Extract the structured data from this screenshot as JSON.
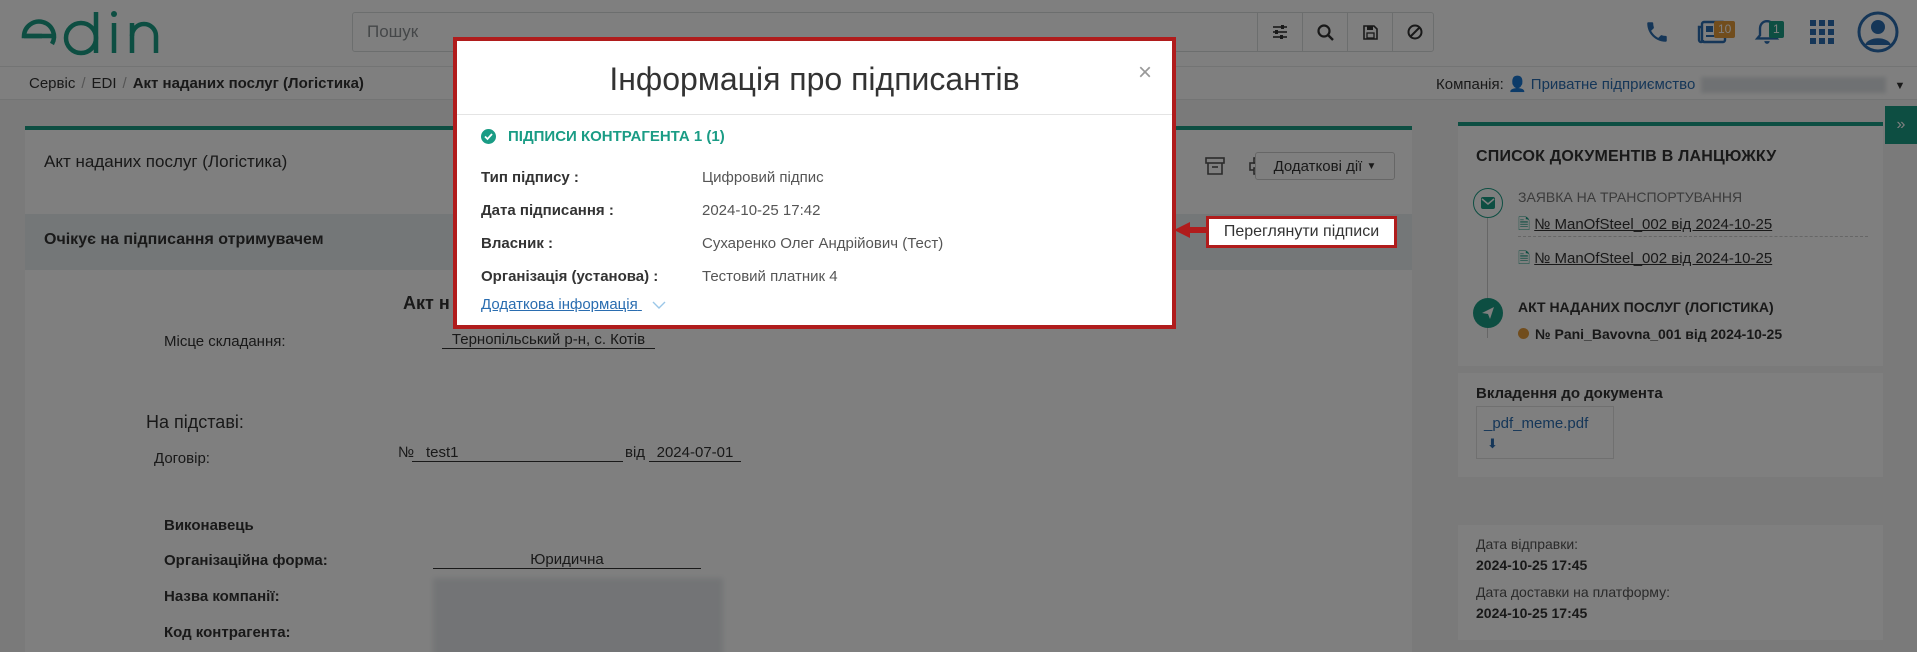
{
  "header": {
    "search_placeholder": "Пошук",
    "catalog_badge": "10",
    "notifications_badge": "1"
  },
  "breadcrumb": {
    "items": [
      "Сервіс",
      "EDI",
      "Акт наданих послуг (Логістика)"
    ],
    "company_label": "Компанія:",
    "company_name": "Приватне підприємство"
  },
  "document": {
    "title": "Акт наданих послуг (Логістика)",
    "status": "Очікує на підписання отримувачем",
    "view_signatures": "Переглянути підписи",
    "more_actions": "Додаткові дії",
    "body_title_fragment": "Акт н",
    "place_label": "Місце складання:",
    "place_value": "Тернопільський р-н, с. Котів",
    "basis_heading": "На підставі:",
    "contract_label": "Договір:",
    "contract_no_prefix": "№",
    "contract_no": "test1",
    "contract_from": "від",
    "contract_date": "2024-07-01",
    "executor_heading": "Виконавець",
    "org_form_label": "Організаційна форма:",
    "org_form_value": "Юридична",
    "company_name_label": "Назва компанії:",
    "counterparty_code_label": "Код контрагента:"
  },
  "chain": {
    "heading": "СПИСОК ДОКУМЕНТІВ В ЛАНЦЮЖКУ",
    "group1_title": "ЗАЯВКА НА ТРАНСПОРТУВАННЯ",
    "group1_docs": [
      "№ ManOfSteel_002 від 2024-10-25",
      "№ ManOfSteel_002 від 2024-10-25"
    ],
    "group2_title": "АКТ НАДАНИХ ПОСЛУГ (ЛОГІСТИКА)",
    "group2_doc": "№ Pani_Bavovna_001 від 2024-10-25"
  },
  "attachments": {
    "heading": "Вкладення до документа",
    "file": "_pdf_meme.pdf"
  },
  "dates": {
    "sent_label": "Дата відправки:",
    "sent_value": "2024-10-25 17:45",
    "delivered_label": "Дата доставки на платформу:",
    "delivered_value": "2024-10-25 17:45"
  },
  "modal": {
    "title": "Інформація про підписантів",
    "close": "×",
    "section": "ПІДПИСИ КОНТРАГЕНТА 1 (1)",
    "rows": [
      {
        "label": "Тип підпису :",
        "value": "Цифровий підпис"
      },
      {
        "label": "Дата підписання :",
        "value": "2024-10-25 17:42"
      },
      {
        "label": "Власник :",
        "value": "Сухаренко Олег Андрійович (Тест)"
      },
      {
        "label": "Організація (установа) :",
        "value": "Тестовий платник 4"
      }
    ],
    "more_info": "Додаткова інформація"
  },
  "colors": {
    "brand": "#1a9c85",
    "highlight": "#b01c1c",
    "link": "#2a6db0",
    "badge_orange": "#e39a3a",
    "badge_green": "#1a9c85"
  }
}
